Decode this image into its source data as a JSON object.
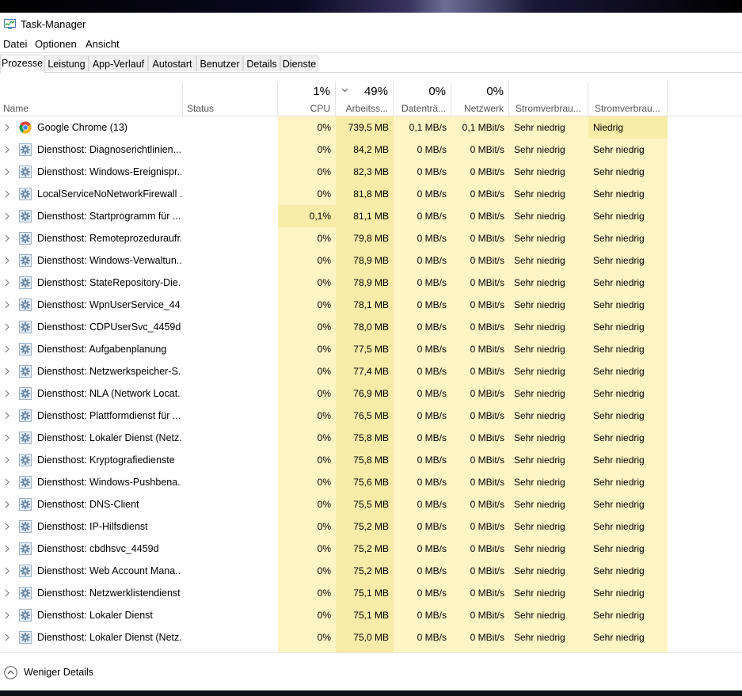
{
  "window": {
    "title": "Task-Manager"
  },
  "menu": [
    "Datei",
    "Optionen",
    "Ansicht"
  ],
  "tabs": [
    "Prozesse",
    "Leistung",
    "App-Verlauf",
    "Autostart",
    "Benutzer",
    "Details",
    "Dienste"
  ],
  "active_tab": "Prozesse",
  "columns": {
    "name": "Name",
    "status": "Status",
    "cpu": {
      "pct": "1%",
      "label": "CPU"
    },
    "mem": {
      "pct": "49%",
      "label": "Arbeitss..."
    },
    "disk": {
      "pct": "0%",
      "label": "Datenträ..."
    },
    "net": {
      "pct": "0%",
      "label": "Netzwerk"
    },
    "power": "Stromverbrau...",
    "power_trend": "Stromverbrau..."
  },
  "colors": {
    "heat_light": "#fff4c4",
    "heat_mid": "#f9eca8",
    "heat_strong": "#f3e08e",
    "row_hover": "#fff4c4"
  },
  "processes": [
    {
      "name": "Google Chrome (13)",
      "icon": "chrome-icon",
      "cpu": "0%",
      "mem": "739,5 MB",
      "disk": "0,1 MB/s",
      "net": "0,1 MBit/s",
      "power": "Sehr niedrig",
      "trend": "Niedrig"
    },
    {
      "name": "Diensthost: Diagnoserichtlinien...",
      "icon": "gear-icon",
      "cpu": "0%",
      "mem": "84,2 MB",
      "disk": "0 MB/s",
      "net": "0 MBit/s",
      "power": "Sehr niedrig",
      "trend": "Sehr niedrig"
    },
    {
      "name": "Diensthost: Windows-Ereignispr...",
      "icon": "gear-icon",
      "cpu": "0%",
      "mem": "82,3 MB",
      "disk": "0 MB/s",
      "net": "0 MBit/s",
      "power": "Sehr niedrig",
      "trend": "Sehr niedrig"
    },
    {
      "name": "LocalServiceNoNetworkFirewall ...",
      "icon": "gear-icon",
      "cpu": "0%",
      "mem": "81,8 MB",
      "disk": "0 MB/s",
      "net": "0 MBit/s",
      "power": "Sehr niedrig",
      "trend": "Sehr niedrig"
    },
    {
      "name": "Diensthost: Startprogramm für ...",
      "icon": "gear-icon",
      "cpu": "0,1%",
      "mem": "81,1 MB",
      "disk": "0 MB/s",
      "net": "0 MBit/s",
      "power": "Sehr niedrig",
      "trend": "Sehr niedrig"
    },
    {
      "name": "Diensthost: Remoteprozeduraufr...",
      "icon": "gear-icon",
      "cpu": "0%",
      "mem": "79,8 MB",
      "disk": "0 MB/s",
      "net": "0 MBit/s",
      "power": "Sehr niedrig",
      "trend": "Sehr niedrig"
    },
    {
      "name": "Diensthost: Windows-Verwaltun...",
      "icon": "gear-icon",
      "cpu": "0%",
      "mem": "78,9 MB",
      "disk": "0 MB/s",
      "net": "0 MBit/s",
      "power": "Sehr niedrig",
      "trend": "Sehr niedrig"
    },
    {
      "name": "Diensthost: StateRepository-Die...",
      "icon": "gear-icon",
      "cpu": "0%",
      "mem": "78,9 MB",
      "disk": "0 MB/s",
      "net": "0 MBit/s",
      "power": "Sehr niedrig",
      "trend": "Sehr niedrig"
    },
    {
      "name": "Diensthost: WpnUserService_44...",
      "icon": "gear-icon",
      "cpu": "0%",
      "mem": "78,1 MB",
      "disk": "0 MB/s",
      "net": "0 MBit/s",
      "power": "Sehr niedrig",
      "trend": "Sehr niedrig"
    },
    {
      "name": "Diensthost: CDPUserSvc_4459d",
      "icon": "gear-icon",
      "cpu": "0%",
      "mem": "78,0 MB",
      "disk": "0 MB/s",
      "net": "0 MBit/s",
      "power": "Sehr niedrig",
      "trend": "Sehr niedrig"
    },
    {
      "name": "Diensthost: Aufgabenplanung",
      "icon": "gear-icon",
      "cpu": "0%",
      "mem": "77,5 MB",
      "disk": "0 MB/s",
      "net": "0 MBit/s",
      "power": "Sehr niedrig",
      "trend": "Sehr niedrig"
    },
    {
      "name": "Diensthost: Netzwerkspeicher-S...",
      "icon": "gear-icon",
      "cpu": "0%",
      "mem": "77,4 MB",
      "disk": "0 MB/s",
      "net": "0 MBit/s",
      "power": "Sehr niedrig",
      "trend": "Sehr niedrig"
    },
    {
      "name": "Diensthost: NLA (Network Locat...",
      "icon": "gear-icon",
      "cpu": "0%",
      "mem": "76,9 MB",
      "disk": "0 MB/s",
      "net": "0 MBit/s",
      "power": "Sehr niedrig",
      "trend": "Sehr niedrig"
    },
    {
      "name": "Diensthost: Plattformdienst für ...",
      "icon": "gear-icon",
      "cpu": "0%",
      "mem": "76,5 MB",
      "disk": "0 MB/s",
      "net": "0 MBit/s",
      "power": "Sehr niedrig",
      "trend": "Sehr niedrig"
    },
    {
      "name": "Diensthost: Lokaler Dienst (Netz...",
      "icon": "gear-icon",
      "cpu": "0%",
      "mem": "75,8 MB",
      "disk": "0 MB/s",
      "net": "0 MBit/s",
      "power": "Sehr niedrig",
      "trend": "Sehr niedrig"
    },
    {
      "name": "Diensthost: Kryptografiedienste",
      "icon": "gear-icon",
      "cpu": "0%",
      "mem": "75,8 MB",
      "disk": "0 MB/s",
      "net": "0 MBit/s",
      "power": "Sehr niedrig",
      "trend": "Sehr niedrig"
    },
    {
      "name": "Diensthost: Windows-Pushbena...",
      "icon": "gear-icon",
      "cpu": "0%",
      "mem": "75,6 MB",
      "disk": "0 MB/s",
      "net": "0 MBit/s",
      "power": "Sehr niedrig",
      "trend": "Sehr niedrig"
    },
    {
      "name": "Diensthost: DNS-Client",
      "icon": "gear-icon",
      "cpu": "0%",
      "mem": "75,5 MB",
      "disk": "0 MB/s",
      "net": "0 MBit/s",
      "power": "Sehr niedrig",
      "trend": "Sehr niedrig"
    },
    {
      "name": "Diensthost: IP-Hilfsdienst",
      "icon": "gear-icon",
      "cpu": "0%",
      "mem": "75,2 MB",
      "disk": "0 MB/s",
      "net": "0 MBit/s",
      "power": "Sehr niedrig",
      "trend": "Sehr niedrig"
    },
    {
      "name": "Diensthost: cbdhsvc_4459d",
      "icon": "gear-icon",
      "cpu": "0%",
      "mem": "75,2 MB",
      "disk": "0 MB/s",
      "net": "0 MBit/s",
      "power": "Sehr niedrig",
      "trend": "Sehr niedrig"
    },
    {
      "name": "Diensthost: Web Account Mana...",
      "icon": "gear-icon",
      "cpu": "0%",
      "mem": "75,2 MB",
      "disk": "0 MB/s",
      "net": "0 MBit/s",
      "power": "Sehr niedrig",
      "trend": "Sehr niedrig"
    },
    {
      "name": "Diensthost: Netzwerklistendienst",
      "icon": "gear-icon",
      "cpu": "0%",
      "mem": "75,1 MB",
      "disk": "0 MB/s",
      "net": "0 MBit/s",
      "power": "Sehr niedrig",
      "trend": "Sehr niedrig"
    },
    {
      "name": "Diensthost: Lokaler Dienst",
      "icon": "gear-icon",
      "cpu": "0%",
      "mem": "75,1 MB",
      "disk": "0 MB/s",
      "net": "0 MBit/s",
      "power": "Sehr niedrig",
      "trend": "Sehr niedrig"
    },
    {
      "name": "Diensthost: Lokaler Dienst (Netz...",
      "icon": "gear-icon",
      "cpu": "0%",
      "mem": "75,0 MB",
      "disk": "0 MB/s",
      "net": "0 MBit/s",
      "power": "Sehr niedrig",
      "trend": "Sehr niedrig"
    }
  ],
  "footer": {
    "less_details": "Weniger Details"
  }
}
